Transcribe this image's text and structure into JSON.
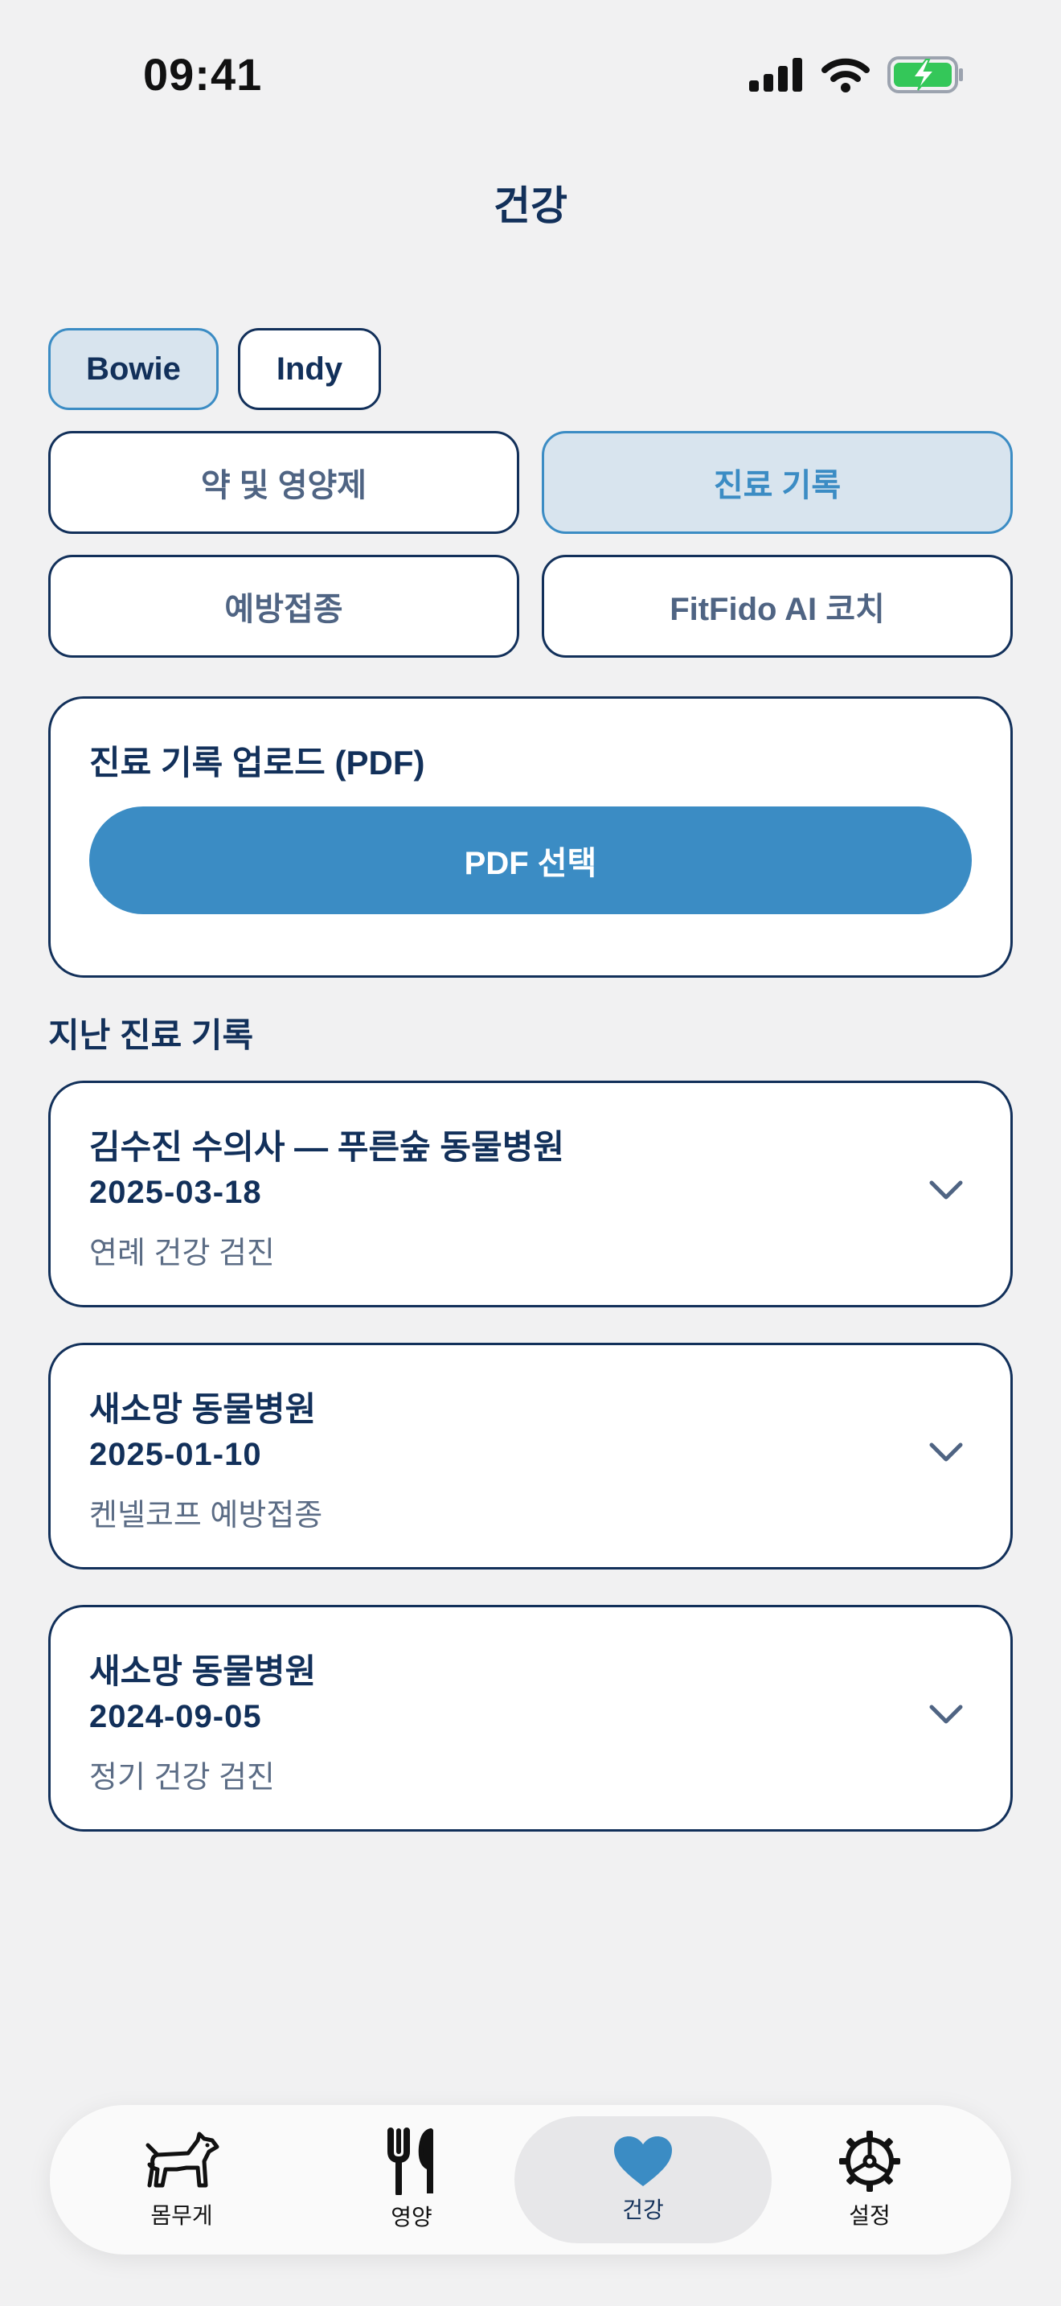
{
  "status": {
    "time": "09:41"
  },
  "header": {
    "title": "건강"
  },
  "pets": [
    {
      "name": "Bowie",
      "selected": true
    },
    {
      "name": "Indy",
      "selected": false
    }
  ],
  "sections": [
    {
      "label": "약 및 영양제",
      "selected": false
    },
    {
      "label": "진료 기록",
      "selected": true
    },
    {
      "label": "예방접종",
      "selected": false
    },
    {
      "label": "FitFido AI 코치",
      "selected": false
    }
  ],
  "upload": {
    "title": "진료 기록 업로드 (PDF)",
    "button_label": "PDF 선택"
  },
  "past_records": {
    "label": "지난 진료 기록",
    "items": [
      {
        "title": "김수진 수의사 — 푸른숲 동물병원",
        "date": "2025-03-18",
        "description": "연례 건강 검진"
      },
      {
        "title": "새소망 동물병원",
        "date": "2025-01-10",
        "description": "켄넬코프 예방접종"
      },
      {
        "title": "새소망 동물병원",
        "date": "2024-09-05",
        "description": "정기 건강 검진"
      }
    ]
  },
  "tabbar": {
    "items": [
      {
        "label": "몸무게",
        "icon": "dog-icon"
      },
      {
        "label": "영양",
        "icon": "fork-knife-icon"
      },
      {
        "label": "건강",
        "icon": "heart-icon",
        "active": true
      },
      {
        "label": "설정",
        "icon": "gear-icon"
      }
    ]
  },
  "colors": {
    "accent": "#3b8cc4",
    "navy": "#12305a",
    "selected_bg": "#d8e4ee",
    "battery_green": "#34c759"
  }
}
